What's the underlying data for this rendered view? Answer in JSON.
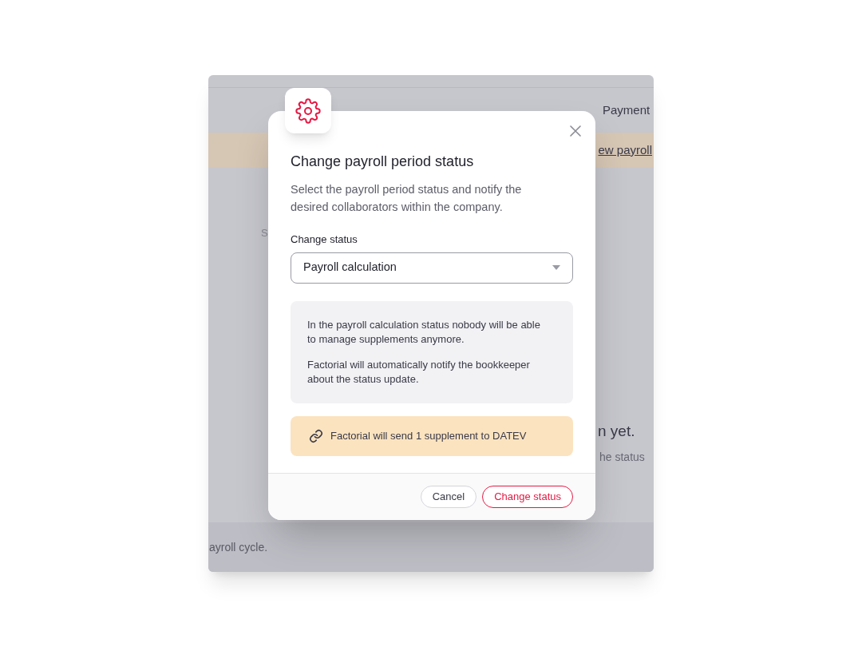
{
  "background_page": {
    "tabs": [
      {
        "label": "Payment"
      }
    ],
    "banner_link": "ew payroll",
    "stray_letter": "S",
    "empty_title": "n yet.",
    "empty_text": "he status",
    "footer_text": "ayroll cycle."
  },
  "dialog": {
    "title": "Change payroll period status",
    "description": "Select the payroll period status and notify the desired collaborators within the company.",
    "field": {
      "label": "Change status",
      "value": "Payroll calculation"
    },
    "info": [
      "In the payroll calculation status nobody will be able to manage supplements anymore.",
      "Factorial will automatically notify the bookkeeper about the status update."
    ],
    "notice": "Factorial will send 1 supplement to DATEV",
    "buttons": [
      {
        "label": "Cancel",
        "kind": "secondary"
      },
      {
        "label": "Change status",
        "kind": "primary"
      }
    ]
  }
}
